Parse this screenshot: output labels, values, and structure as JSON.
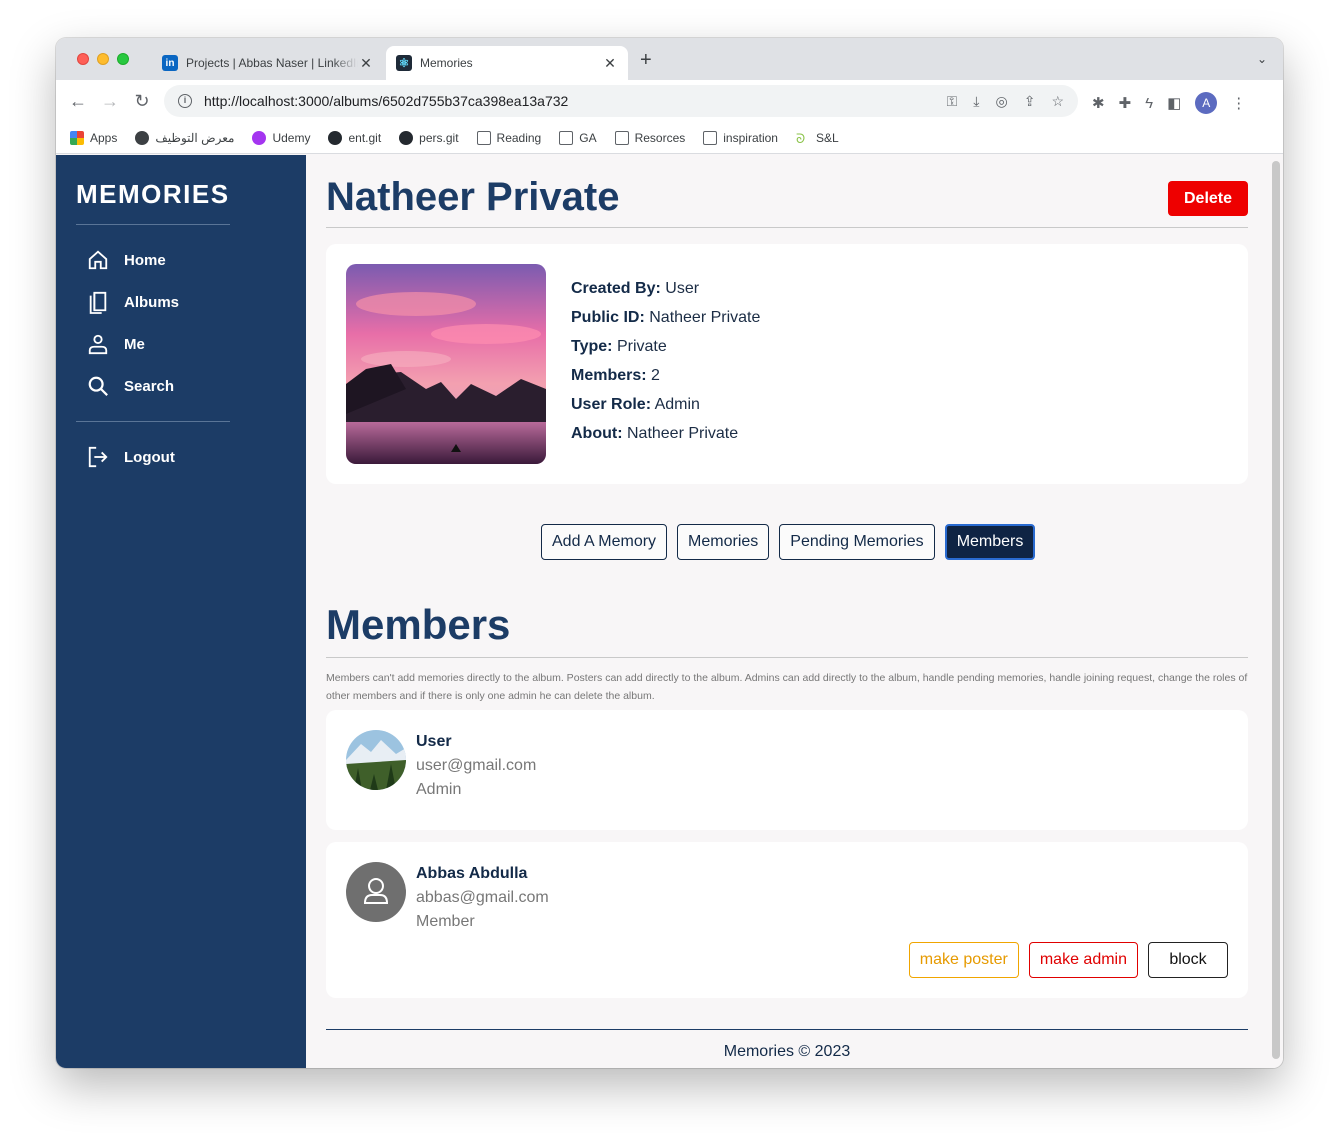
{
  "browser": {
    "tabs": [
      {
        "title": "Projects | Abbas Naser | LinkedIn",
        "icon": "linkedin-icon"
      },
      {
        "title": "Memories",
        "icon": "react-icon"
      }
    ],
    "url": "http://localhost:3000/albums/6502d755b37ca398ea13a732",
    "profile_initial": "A",
    "bookmarks": [
      {
        "label": "Apps",
        "icon": "apps-grid-icon"
      },
      {
        "label": "معرض التوظيف",
        "icon": "globe-icon"
      },
      {
        "label": "Udemy",
        "icon": "udemy-icon"
      },
      {
        "label": "ent.git",
        "icon": "github-icon"
      },
      {
        "label": "pers.git",
        "icon": "github-icon"
      },
      {
        "label": "Reading",
        "icon": "folder-icon"
      },
      {
        "label": "GA",
        "icon": "folder-icon"
      },
      {
        "label": "Resorces",
        "icon": "folder-icon"
      },
      {
        "label": "inspiration",
        "icon": "folder-icon"
      },
      {
        "label": "S&L",
        "icon": "snake-icon"
      }
    ]
  },
  "sidebar": {
    "brand": "MEMORIES",
    "items": [
      {
        "label": "Home",
        "icon": "home-icon"
      },
      {
        "label": "Albums",
        "icon": "book-icon"
      },
      {
        "label": "Me",
        "icon": "user-icon"
      },
      {
        "label": "Search",
        "icon": "search-icon"
      }
    ],
    "logout": {
      "label": "Logout",
      "icon": "logout-icon"
    }
  },
  "album": {
    "title": "Natheer Private",
    "delete_label": "Delete",
    "details": [
      {
        "label": "Created By:",
        "value": "User"
      },
      {
        "label": "Public ID:",
        "value": "Natheer Private"
      },
      {
        "label": "Type:",
        "value": "Private"
      },
      {
        "label": "Members:",
        "value": "2"
      },
      {
        "label": "User Role:",
        "value": "Admin"
      },
      {
        "label": "About:",
        "value": "Natheer Private"
      }
    ]
  },
  "album_tabs": [
    "Add A Memory",
    "Memories",
    "Pending Memories",
    "Members"
  ],
  "active_tab": "Members",
  "members_section": {
    "title": "Members",
    "note": "Members can't add memories directly to the album. Posters can add directly to the album. Admins can add directly to the album, handle pending memories, handle joining request, change the roles of other members and if there is only one admin he can delete the album.",
    "members": [
      {
        "name": "User",
        "email": "user@gmail.com",
        "role": "Admin"
      },
      {
        "name": "Abbas Abdulla",
        "email": "abbas@gmail.com",
        "role": "Member",
        "actions": {
          "poster": "make poster",
          "admin": "make admin",
          "block": "block"
        }
      }
    ]
  },
  "footer": "Memories © 2023",
  "colors": {
    "sidebar": "#1c3c66",
    "primary_text": "#132a48",
    "delete": "#ee0000",
    "poster": "#e69a00",
    "admin": "#e00000"
  }
}
